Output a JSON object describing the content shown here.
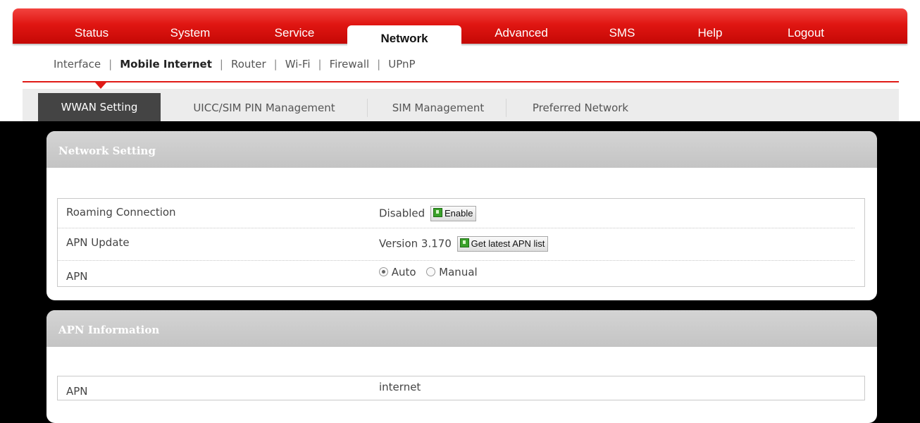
{
  "menu": {
    "items": [
      "Status",
      "System",
      "Service",
      "Network",
      "Advanced",
      "SMS",
      "Help",
      "Logout"
    ],
    "active": "Network"
  },
  "subnav": {
    "items": [
      "Interface",
      "Mobile Internet",
      "Router",
      "Wi-Fi",
      "Firewall",
      "UPnP"
    ],
    "active": "Mobile Internet",
    "separator": "|"
  },
  "tabs": {
    "items": [
      "WWAN Setting",
      "UICC/SIM PIN Management",
      "SIM Management",
      "Preferred Network"
    ],
    "active": "WWAN Setting"
  },
  "network_setting": {
    "title": "Network Setting",
    "roaming_label": "Roaming Connection",
    "roaming_value": "Disabled",
    "roaming_button": "Enable",
    "apn_update_label": "APN Update",
    "apn_update_value": "Version 3.170",
    "apn_update_button": "Get latest APN list",
    "apn_label": "APN",
    "apn_option_auto": "Auto",
    "apn_option_manual": "Manual",
    "apn_selected": "Auto"
  },
  "apn_information": {
    "title": "APN Information",
    "apn_label": "APN",
    "apn_value": "internet"
  },
  "colors": {
    "brand_red": "#e01612",
    "active_tab": "#444444",
    "button_icon_green": "#3aa12a"
  }
}
